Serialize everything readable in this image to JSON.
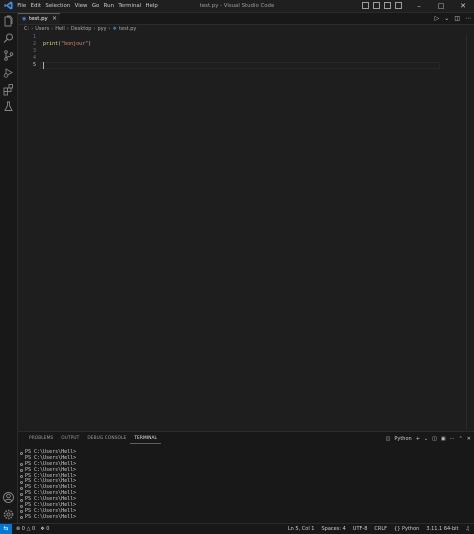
{
  "menu": [
    "File",
    "Edit",
    "Selection",
    "View",
    "Go",
    "Run",
    "Terminal",
    "Help"
  ],
  "window_title": "test.py - Visual Studio Code",
  "tab": {
    "name": "test.py",
    "close": "×",
    "icon": "python-file-icon"
  },
  "breadcrumb": [
    "C:",
    "Users",
    "Hell",
    "Desktop",
    "pyy",
    "test.py"
  ],
  "editor": {
    "line_numbers": [
      "1",
      "2",
      "3",
      "4",
      "5"
    ],
    "code": {
      "fn": "print",
      "open": "(",
      "str": "\"bonjour\"",
      "close": ")"
    }
  },
  "panel": {
    "tabs": [
      "PROBLEMS",
      "OUTPUT",
      "DEBUG CONSOLE",
      "TERMINAL"
    ],
    "active_tab": "TERMINAL",
    "shell": "Python",
    "terminal_lines": [
      "PS C:\\Users\\Hell>",
      "PS C:\\Users\\Hell>",
      "PS C:\\Users\\Hell>",
      "PS C:\\Users\\Hell>",
      "PS C:\\Users\\Hell>",
      "PS C:\\Users\\Hell>",
      "PS C:\\Users\\Hell>",
      "PS C:\\Users\\Hell>",
      "PS C:\\Users\\Hell>",
      "PS C:\\Users\\Hell>",
      "PS C:\\Users\\Hell>",
      "PS C:\\Users\\Hell>"
    ]
  },
  "status": {
    "errors": "0",
    "warnings": "0",
    "ports": "0",
    "position": "Ln 5, Col 1",
    "spaces": "Spaces: 4",
    "encoding": "UTF-8",
    "eol": "CRLF",
    "language": "Python",
    "interpreter": "3.11.1 64-bit"
  },
  "colors": {
    "accent": "#0078d4",
    "editor_bg": "#1e1e1e",
    "chrome_bg": "#181818",
    "string": "#ce9178",
    "function": "#dcdcaa"
  }
}
